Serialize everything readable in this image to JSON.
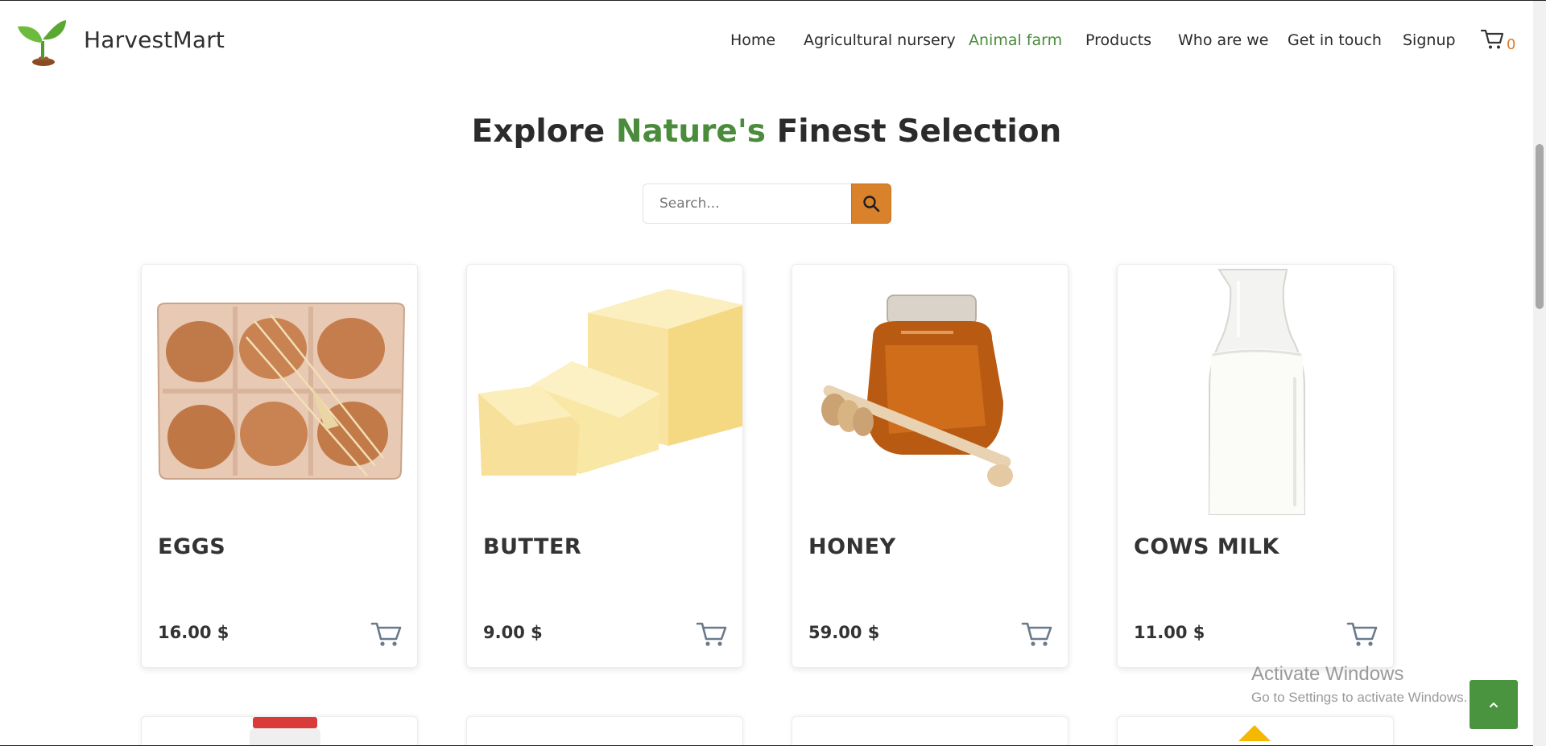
{
  "brand": {
    "name": "HarvestMart",
    "logo_icon": "sprout-icon"
  },
  "nav": {
    "items": [
      {
        "label": "Home",
        "active": false
      },
      {
        "label": "Agricultural nursery",
        "active": false
      },
      {
        "label": "Animal farm",
        "active": true
      },
      {
        "label": "Products",
        "active": false
      },
      {
        "label": "Who are we",
        "active": false
      },
      {
        "label": "Get in touch",
        "active": false
      },
      {
        "label": "Signup",
        "active": false
      }
    ],
    "cart_icon": "cart-icon",
    "cart_count": "0"
  },
  "hero": {
    "title_start": "Explore ",
    "title_accent": "Nature's",
    "title_end": " Finest Selection"
  },
  "search": {
    "placeholder": "Search...",
    "value": "",
    "button_icon": "search-icon"
  },
  "products": [
    {
      "name": "EGGS",
      "price": "16.00 $",
      "image": "eggs-image"
    },
    {
      "name": "BUTTER",
      "price": "9.00 $",
      "image": "butter-image"
    },
    {
      "name": "HONEY",
      "price": "59.00 $",
      "image": "honey-image"
    },
    {
      "name": "COWS MILK",
      "price": "11.00 $",
      "image": "milk-image"
    }
  ],
  "watermark": {
    "line1": "Activate Windows",
    "line2": "Go to Settings to activate Windows."
  },
  "colors": {
    "accent_green": "#4a8c3b",
    "accent_orange": "#d9822b",
    "back_to_top": "#4a9440"
  }
}
